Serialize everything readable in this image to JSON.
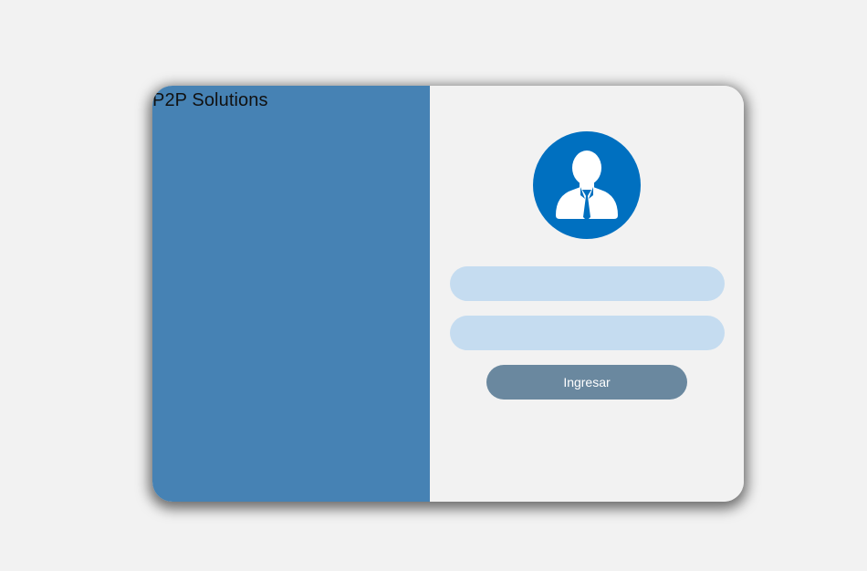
{
  "brand": {
    "title": "P2P Solutions"
  },
  "login": {
    "avatar_icon": "user-businessman-icon",
    "username": {
      "value": "",
      "placeholder": ""
    },
    "password": {
      "value": "",
      "placeholder": ""
    },
    "submit_label": "Ingresar"
  },
  "colors": {
    "page_background": "#f2f2f2",
    "left_panel": "#4682b4",
    "right_panel": "#f2f2f2",
    "avatar_background": "#0070c0",
    "input_background": "#c5dcf0",
    "button_background": "#6a889f",
    "button_text": "#ffffff"
  }
}
